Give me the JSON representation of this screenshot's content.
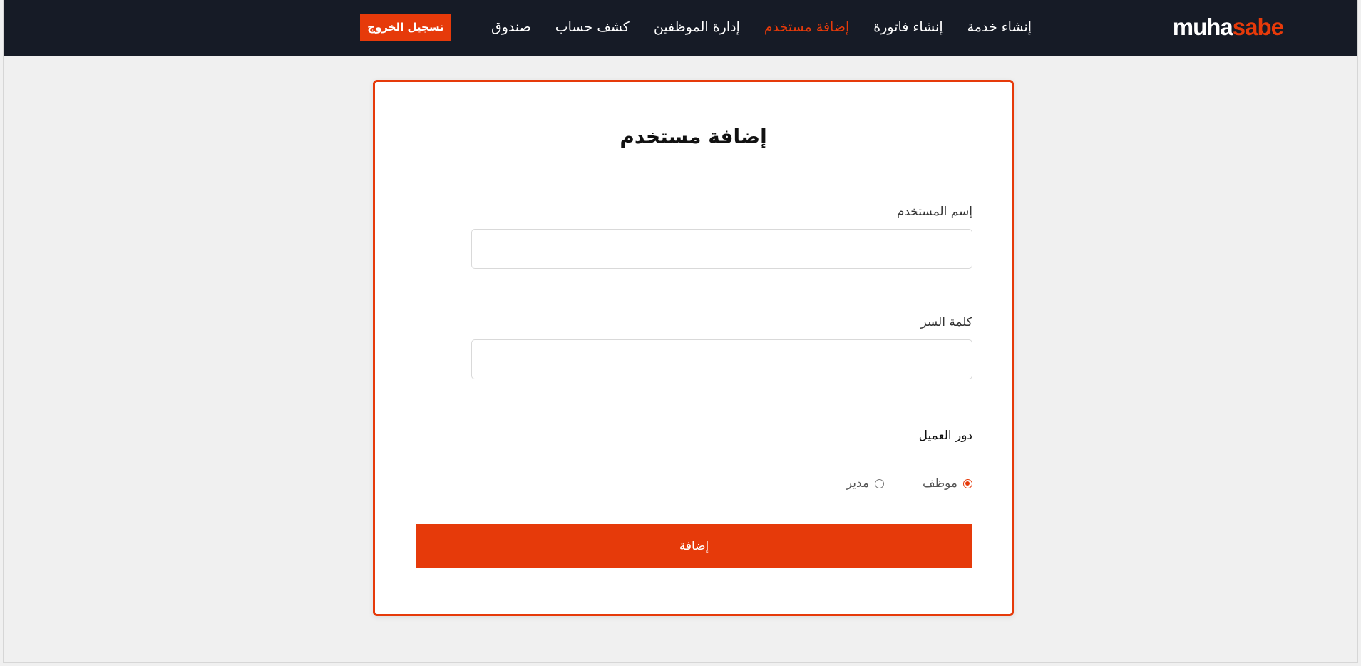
{
  "navbar": {
    "brand_part1": "muha",
    "brand_part2": "sabe",
    "links": [
      {
        "label": "إنشاء خدمة"
      },
      {
        "label": "إنشاء فاتورة"
      },
      {
        "label": "إضافة مستخدم"
      },
      {
        "label": "إدارة الموظفين"
      },
      {
        "label": "كشف حساب"
      },
      {
        "label": "صندوق"
      }
    ],
    "active_link": "إضافة مستخدم",
    "logout_label": "تسجيل الخروج"
  },
  "form": {
    "title": "إضافة مستخدم",
    "username_label": "إسم المستخدم",
    "username_value": "",
    "password_label": "كلمة السر",
    "password_value": "",
    "role_label": "دور العميل",
    "roles": [
      {
        "label": "موظف",
        "checked": true
      },
      {
        "label": "مدير",
        "checked": false
      }
    ],
    "submit_label": "إضافة"
  },
  "colors": {
    "navbar_bg": "#161b26",
    "accent": "#e63a0a",
    "page_bg": "#f0f0f0"
  }
}
